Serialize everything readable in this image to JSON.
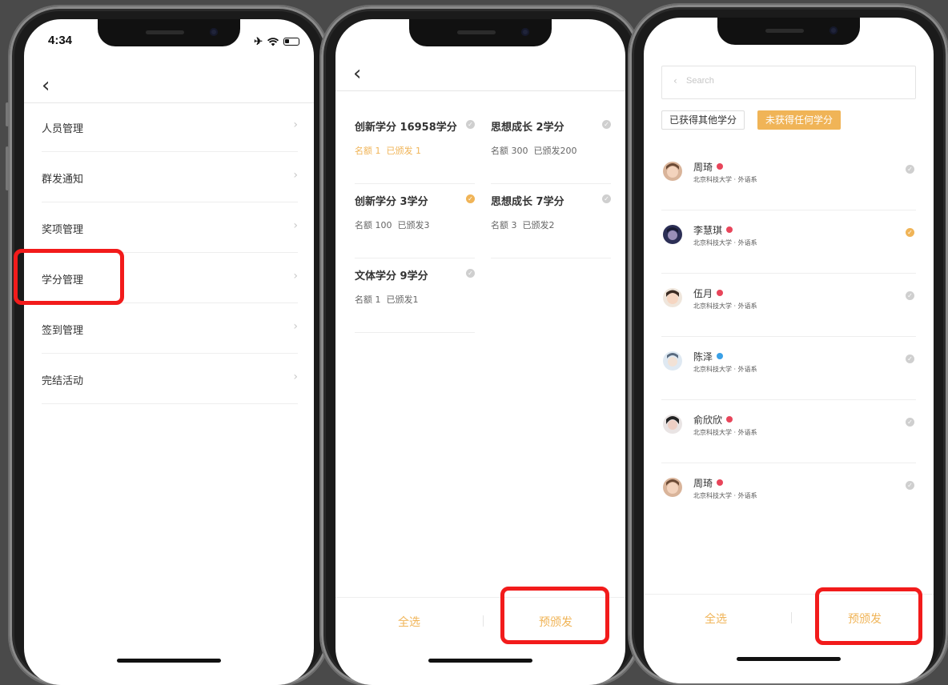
{
  "colors": {
    "accent": "#f0b457",
    "highlight": "#f21b1b",
    "female": "#e8455a",
    "male": "#3aa0e6"
  },
  "phone1": {
    "status": {
      "time": "4:34",
      "icons": [
        "airplane-icon",
        "wifi-icon",
        "battery-icon"
      ]
    },
    "menu": [
      {
        "label": "人员管理"
      },
      {
        "label": "群发通知"
      },
      {
        "label": "奖项管理"
      },
      {
        "label": "学分管理"
      },
      {
        "label": "签到管理"
      },
      {
        "label": "完结活动"
      }
    ]
  },
  "phone2": {
    "cards": [
      {
        "title": "创新学分 16958学分",
        "quota": "名额 1",
        "issued": "已颁发 1",
        "selected": false,
        "highlighted": true
      },
      {
        "title": "思想成长 2学分",
        "quota": "名额 300",
        "issued": "已颁发200",
        "selected": false,
        "highlighted": false
      },
      {
        "title": "创新学分 3学分",
        "quota": "名额 100",
        "issued": "已颁发3",
        "selected": true,
        "highlighted": false
      },
      {
        "title": "思想成长 7学分",
        "quota": "名额 3",
        "issued": "已颁发2",
        "selected": false,
        "highlighted": false
      },
      {
        "title": "文体学分 9学分",
        "quota": "名额 1",
        "issued": "已颁发1",
        "selected": false,
        "highlighted": false
      }
    ],
    "bottom": {
      "select_all": "全选",
      "pre_issue": "预颁发"
    }
  },
  "phone3": {
    "search": {
      "placeholder": "Search"
    },
    "filters": [
      {
        "label": "已获得其他学分",
        "active": false
      },
      {
        "label": "未获得任何学分",
        "active": true
      }
    ],
    "people": [
      {
        "name": "周琦",
        "gender": "female",
        "school": "北京科技大学 · 外语系",
        "selected": false
      },
      {
        "name": "李慧琪",
        "gender": "female",
        "school": "北京科技大学 · 外语系",
        "selected": true
      },
      {
        "name": "伍月",
        "gender": "female",
        "school": "北京科技大学 · 外语系",
        "selected": false
      },
      {
        "name": "陈泽",
        "gender": "male",
        "school": "北京科技大学 · 外语系",
        "selected": false
      },
      {
        "name": "俞欣欣",
        "gender": "female",
        "school": "北京科技大学 · 外语系",
        "selected": false
      },
      {
        "name": "周琦",
        "gender": "female",
        "school": "北京科技大学 · 外语系",
        "selected": false
      }
    ],
    "bottom": {
      "select_all": "全选",
      "pre_issue": "预颁发"
    }
  }
}
